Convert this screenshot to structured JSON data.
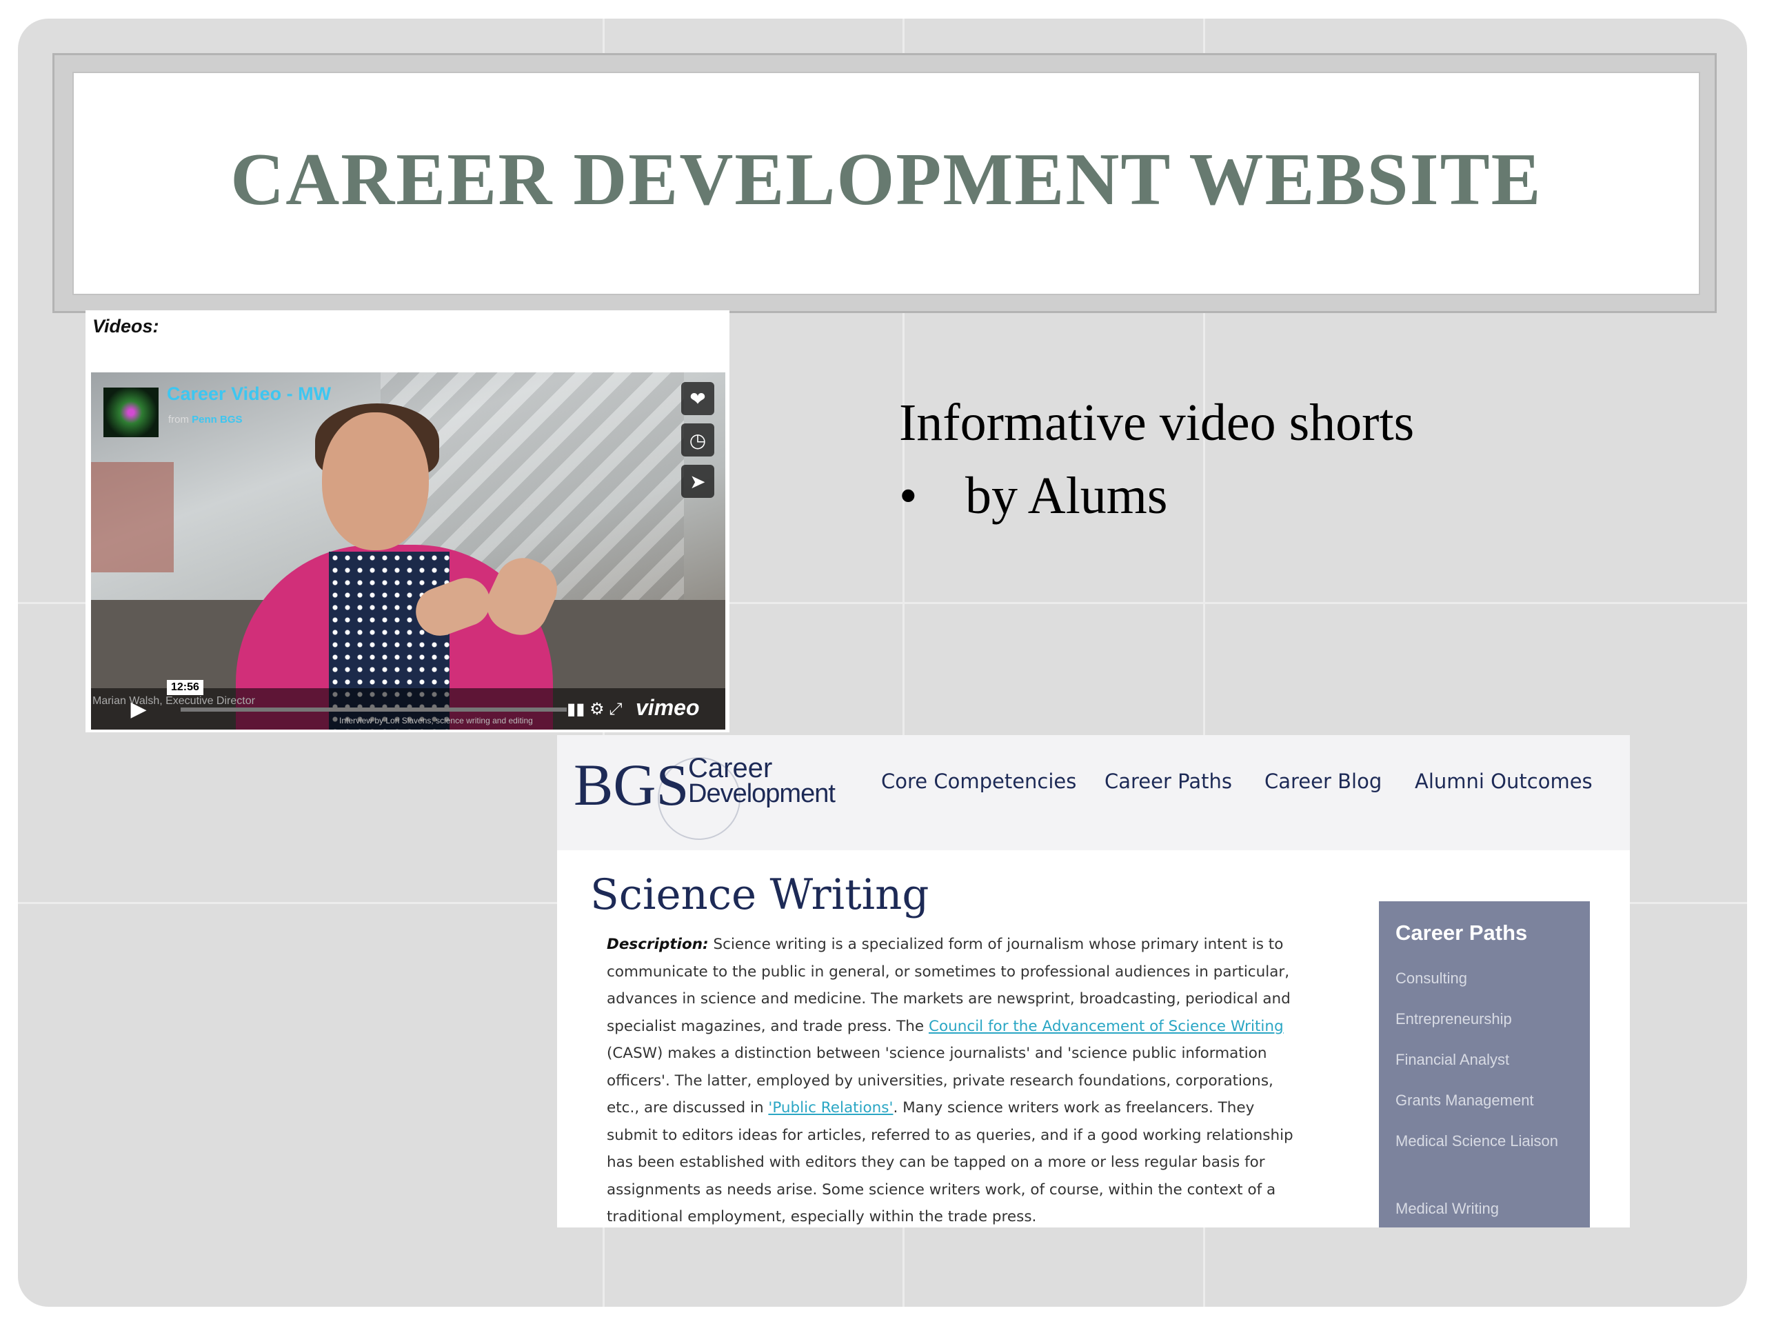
{
  "slide": {
    "title": "CAREER DEVELOPMENT WEBSITE",
    "info_line1": "Informative video shorts",
    "info_bullet": "•",
    "info_line2": "by Alums"
  },
  "video": {
    "section_label": "Videos:",
    "title": "Career Video - MW",
    "from_prefix": "from",
    "from_source": "Penn BGS",
    "duration": "12:56",
    "speaker_caption": "Marian Walsh, Executive Director",
    "bottom_caption": "Interview by Lori Slavens, science writing and editing",
    "brand": "vimeo",
    "icons": [
      "heart-icon",
      "clock-icon",
      "send-icon",
      "play-icon",
      "volume-icon",
      "settings-icon",
      "fullscreen-icon"
    ]
  },
  "website": {
    "logo_main": "BGS",
    "logo_line1": "Career",
    "logo_line2": "Development",
    "nav": [
      "Core Competencies",
      "Career Paths",
      "Career Blog",
      "Alumni Outcomes"
    ],
    "page_title": "Science Writing",
    "description_label": "Description:",
    "description_part1": " Science writing is a specialized form of journalism whose primary intent is to communicate to the public in general, or sometimes to professional audiences in particular, advances in science and medicine. The markets are newsprint, broadcasting, periodical and specialist magazines, and trade press. The ",
    "description_link1": "Council for the Advancement of Science Writing",
    "description_part2": " (CASW) makes a distinction between 'science journalists' and 'science public information officers'. The latter, employed by universities, private research foundations, corporations, etc., are discussed in ",
    "description_link2": "'Public Relations'",
    "description_part3": ". Many science writers work as freelancers. They submit to editors ideas for articles, referred to as queries, and if a good working relationship has been established with editors they can be tapped on a more or less regular basis for assignments as needs arise. Some science writers work, of course, within the context of a traditional employment, especially within the trade press.",
    "sidebar_title": "Career Paths",
    "sidebar_items": [
      "Consulting",
      "Entrepreneurship",
      "Financial Analyst",
      "Grants Management",
      "Medical Science Liaison",
      "Medical Writing"
    ]
  },
  "colors": {
    "title": "#677a70",
    "slide_bg": "#dddddd",
    "site_navy": "#1d2a56",
    "sidebar_bg": "#7c839d",
    "link": "#2aa6c4",
    "video_title": "#3ec6f0"
  }
}
